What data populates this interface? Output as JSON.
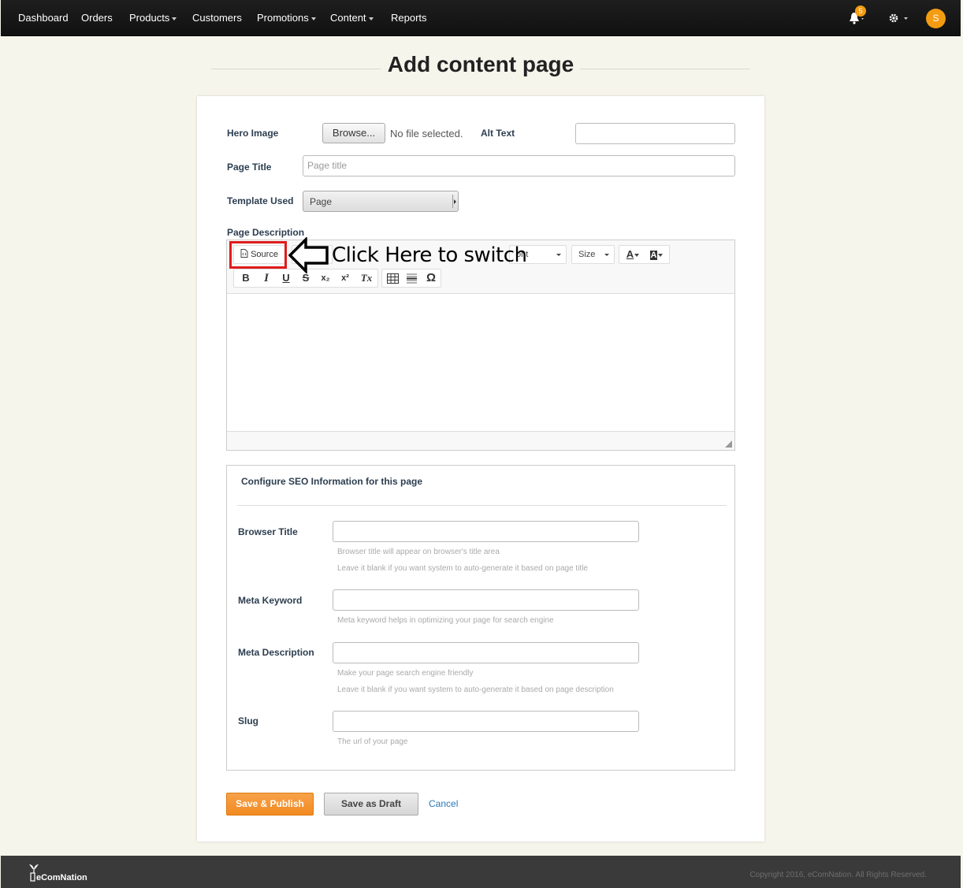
{
  "nav": {
    "dashboard": "Dashboard",
    "orders": "Orders",
    "products": "Products",
    "customers": "Customers",
    "promotions": "Promotions",
    "content": "Content",
    "reports": "Reports",
    "notification_count": "5",
    "avatar_initial": "S"
  },
  "page": {
    "title": "Add content page"
  },
  "form": {
    "hero_image_label": "Hero Image",
    "browse_label": "Browse...",
    "no_file": "No file selected.",
    "alt_text_label": "Alt Text",
    "alt_text_value": "",
    "page_title_label": "Page Title",
    "page_title_placeholder": "Page title",
    "template_label": "Template Used",
    "template_value": "Page",
    "description_label": "Page Description"
  },
  "editor": {
    "source_label": "Source",
    "font_label": "ont",
    "size_label": "Size",
    "text_color_label": "A",
    "bg_color_label": "A",
    "bold": "B",
    "italic": "I",
    "underline": "U",
    "strike": "S",
    "subscript": "x₂",
    "superscript": "x²",
    "remove_format": "Tx",
    "special_char": "Ω"
  },
  "annotation": {
    "text": "Click Here to switch"
  },
  "seo": {
    "title": "Configure SEO Information for this page",
    "browser_title_label": "Browser Title",
    "browser_title_help_1": "Browser title will appear on browser's title area",
    "browser_title_help_2": "Leave it blank if you want system to auto-generate it based on page title",
    "meta_keyword_label": "Meta Keyword",
    "meta_keyword_help": "Meta keyword helps in optimizing your page for search engine",
    "meta_description_label": "Meta Description",
    "meta_description_help_1": "Make your page search engine friendly",
    "meta_description_help_2": "Leave it blank if you want system to auto-generate it based on page description",
    "slug_label": "Slug",
    "slug_help": "The url of your page"
  },
  "actions": {
    "publish": "Save & Publish",
    "draft": "Save as Draft",
    "cancel": "Cancel"
  },
  "footer": {
    "brand": "eComNation",
    "copyright": "Copyright 2016, eComNation. All Rights Reserved."
  },
  "colors": {
    "accent": "#f39c12",
    "nav_bg": "#111111",
    "page_bg": "#f6f5ec",
    "highlight": "#e01b1b",
    "link": "#2a7ab8"
  },
  "icons": {
    "notification": "bell-icon",
    "settings": "gear-icon",
    "source": "document-source-icon",
    "table": "table-icon",
    "horizontal_rule": "horizontal-line-icon",
    "arrow": "left-arrow-icon"
  }
}
